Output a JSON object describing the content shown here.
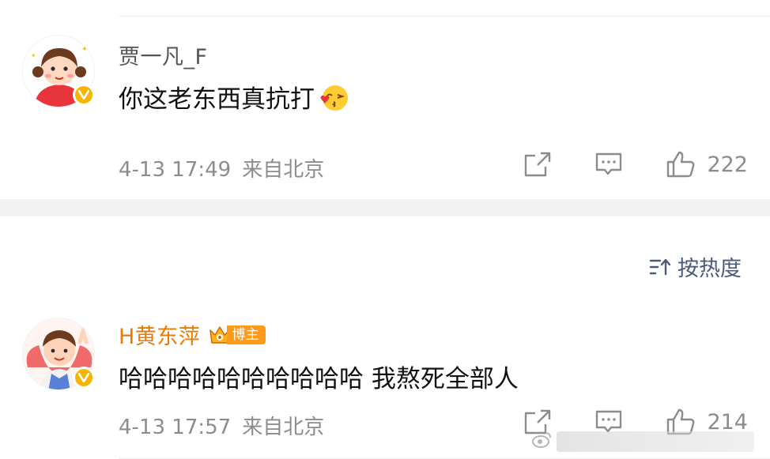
{
  "comments": [
    {
      "username": "贾一凡_F",
      "text": "你这老东西真抗打",
      "emoji": "kiss-emoji",
      "time": "4-13 17:49",
      "location": "来自北京",
      "likes": "222",
      "verified": true
    },
    {
      "username": "H黄东萍",
      "badge": "博主",
      "text": "哈哈哈哈哈哈哈哈哈哈 我熬死全部人",
      "time": "4-13 17:57",
      "location": "来自北京",
      "likes": "214",
      "verified": true
    }
  ],
  "sort": {
    "label": "按热度",
    "icon": "sort-icon"
  },
  "colors": {
    "username_normal": "#555555",
    "username_vip": "#ea7a00",
    "meta": "#8c8c8c",
    "badge": "#ff9a1a",
    "verified": "#f7b500",
    "sort": "#4a5a78"
  }
}
